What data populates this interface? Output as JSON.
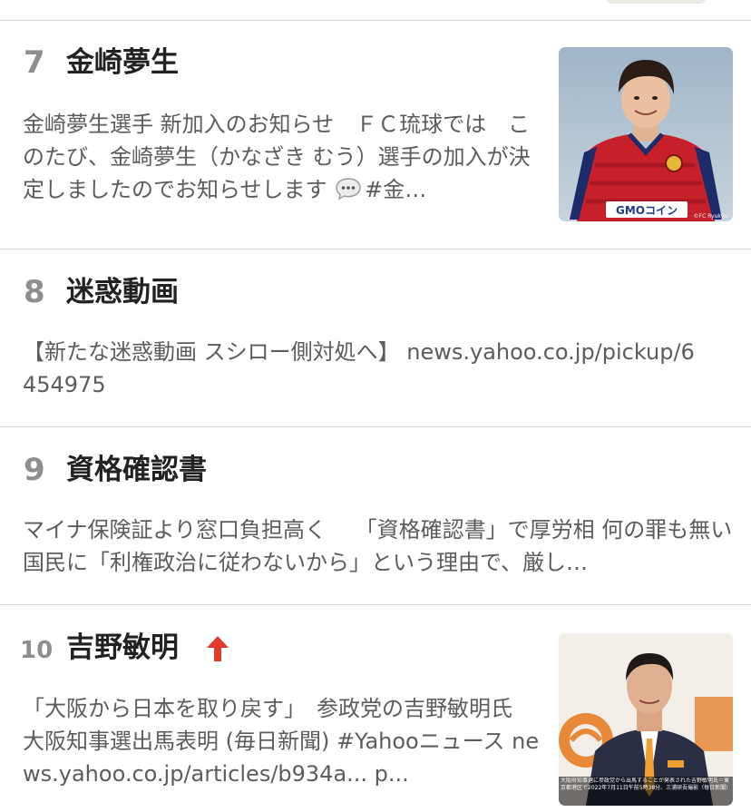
{
  "items": [
    {
      "rank": "7",
      "title": "金崎夢生",
      "desc": "金崎夢生選手 新加入のお知らせ　ＦＣ琉球では　このたび、金崎夢生（かなざき むう）選手の加入が決定しましたのでお知らせします",
      "tag": "#金…",
      "thumb_caption": "GMOコイン",
      "thumb_credit": "©FC Ryukyu"
    },
    {
      "rank": "8",
      "title": "迷惑動画",
      "desc": "【新たな迷惑動画 スシロー側対処へ】 news.yahoo.co.jp/pickup/6454975"
    },
    {
      "rank": "9",
      "title": "資格確認書",
      "desc": "マイナ保険証より窓口負担高く　 「資格確認書」で厚労相  何の罪も無い国民に「利権政治に従わないから」という理由で、厳し…"
    },
    {
      "rank": "10",
      "title": "吉野敏明",
      "trend": "up",
      "desc": "「大阪から日本を取り戻す」　参政党の吉野敏明氏　 大阪知事選出馬表明 (毎日新聞)  #Yahooニュース news.yahoo.co.jp/articles/b934a... p...",
      "thumb_caption": "大阪府知事選に参政党から出馬することが発表された吉野敏明氏＝東京都港区で2022年7月11日午前5時38分、三浦研吾撮影（毎日新聞）"
    }
  ],
  "colors": {
    "rank": "#8e8e8e",
    "title": "#222222",
    "desc": "#5c5c5c",
    "divider": "#d7d7d7",
    "trend_up": "#e03a2f"
  },
  "icons": {
    "comment": "speech-bubble-icon",
    "trend": "arrow-up-icon"
  }
}
